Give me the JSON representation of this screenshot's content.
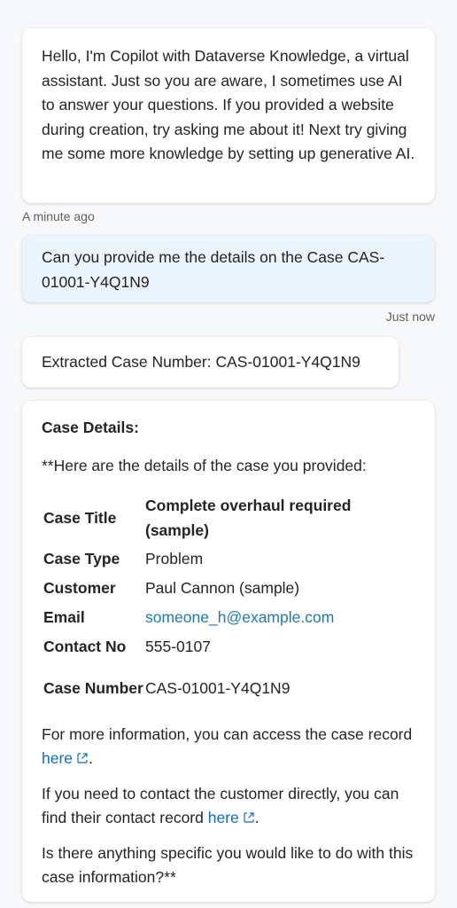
{
  "conversation": {
    "bot_intro": {
      "text": "Hello, I'm Copilot with Dataverse Knowledge, a virtual assistant. Just so you are aware, I sometimes use AI to answer your questions. If you provided a website during creation, try asking me about it! Next try giving me some more knowledge by setting up generative AI.",
      "timestamp": "A minute ago"
    },
    "user_message": {
      "text": "Can you provide me the details on the Case CAS-01001-Y4Q1N9",
      "timestamp": "Just now"
    },
    "extracted": {
      "text": "Extracted Case Number: CAS-01001-Y4Q1N9"
    },
    "case_details": {
      "heading": "Case Details:",
      "intro": "**Here are the details of the case you provided:",
      "rows": [
        {
          "key": "Case Title",
          "value": "Complete overhaul required (sample)"
        },
        {
          "key": "Case Type",
          "value": "Problem"
        },
        {
          "key": "Customer",
          "value": "Paul Cannon (sample)"
        },
        {
          "key": "Email",
          "value": "someone_h@example.com"
        },
        {
          "key": "Contact No",
          "value": "555-0107"
        },
        {
          "key": "Case Number",
          "value": "CAS-01001-Y4Q1N9"
        }
      ],
      "more_info_prefix": "For more information, you can access the case record ",
      "more_info_link": "here",
      "more_info_suffix": ".",
      "contact_prefix": "If you need to contact the customer directly, you can find their contact record ",
      "contact_link": "here",
      "contact_suffix": ".",
      "closing": "Is there anything specific you would like to do with this case information?**"
    }
  },
  "colors": {
    "link": "#0f6cbd",
    "user_bubble": "#ebf3fc",
    "background": "#f7f8fa"
  },
  "icons": {
    "external_link": "open-in-new-window-icon"
  }
}
